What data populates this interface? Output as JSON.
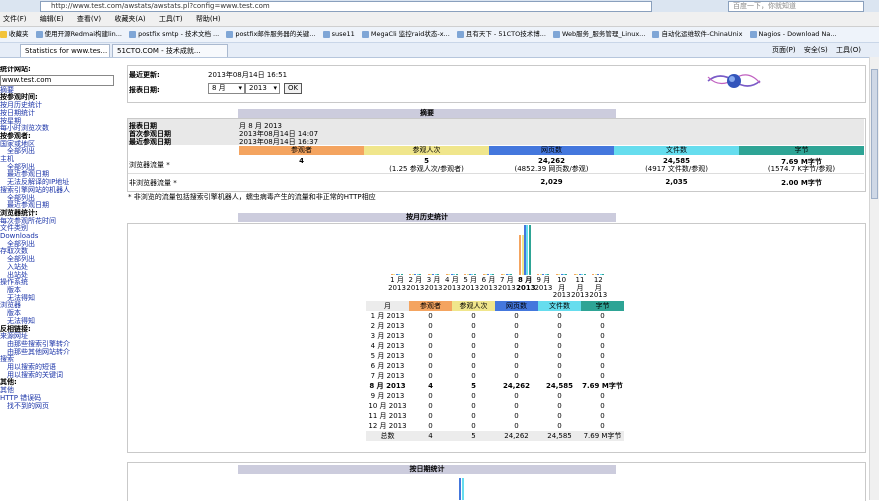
{
  "browser": {
    "url": "http://www.test.com/awstats/awstats.pl?config=www.test.com",
    "search_placeholder": "百度一下，你就知道",
    "menu": [
      "文件(F)",
      "编辑(E)",
      "查看(V)",
      "收藏夹(A)",
      "工具(T)",
      "帮助(H)"
    ],
    "favorites": [
      "收藏夹",
      "使用开源Redmai构建lin...",
      "postfix smtp - 技术文档 ...",
      "postfix邮件服务器的关键...",
      "suse11",
      "MegaCli 监控raid状态-x...",
      "且有天下 - 51CTO技术博...",
      "Web服务_服务管理_Linux...",
      "自动化运维软件-ChinaUnix",
      "Nagios - Download Na..."
    ],
    "tabs": [
      "Statistics for www.tes...",
      "51CTO.COM - 技术成就..."
    ],
    "commands": [
      "页面(P)",
      "安全(S)",
      "工具(O)"
    ]
  },
  "sidebar": {
    "site_label": "统计网站:",
    "site_value": "www.test.com",
    "items": [
      {
        "text": "摘要",
        "type": "lnk"
      },
      {
        "text": "按参观时间:",
        "type": "hdr"
      },
      {
        "text": "按月历史统计",
        "type": "lnk"
      },
      {
        "text": "按日期统计",
        "type": "lnk"
      },
      {
        "text": "按星期",
        "type": "lnk"
      },
      {
        "text": "每小时浏览次数",
        "type": "lnk"
      },
      {
        "text": "按参观者:",
        "type": "hdr"
      },
      {
        "text": "国家或地区",
        "type": "lnk"
      },
      {
        "text": "全部列出",
        "type": "sub"
      },
      {
        "text": "主机",
        "type": "lnk"
      },
      {
        "text": "全部列出",
        "type": "sub"
      },
      {
        "text": "最近参观日期",
        "type": "sub"
      },
      {
        "text": "无法反解译的IP地址",
        "type": "sub"
      },
      {
        "text": "搜索引擎网站的机器人",
        "type": "lnk"
      },
      {
        "text": "全部列出",
        "type": "sub"
      },
      {
        "text": "最近参观日期",
        "type": "sub"
      },
      {
        "text": "浏览器统计:",
        "type": "hdr"
      },
      {
        "text": "每次参观所花时间",
        "type": "lnk"
      },
      {
        "text": "文件类别",
        "type": "lnk"
      },
      {
        "text": "Downloads",
        "type": "lnk"
      },
      {
        "text": "全部列出",
        "type": "sub"
      },
      {
        "text": "存取次数",
        "type": "lnk"
      },
      {
        "text": "全部列出",
        "type": "sub"
      },
      {
        "text": "入站处",
        "type": "sub"
      },
      {
        "text": "出站处",
        "type": "sub"
      },
      {
        "text": "操作系统",
        "type": "lnk"
      },
      {
        "text": "版本",
        "type": "sub"
      },
      {
        "text": "无法得知",
        "type": "sub"
      },
      {
        "text": "浏览器",
        "type": "lnk"
      },
      {
        "text": "版本",
        "type": "sub"
      },
      {
        "text": "无法得知",
        "type": "sub"
      },
      {
        "text": "反相链接:",
        "type": "hdr"
      },
      {
        "text": "来源网址",
        "type": "lnk"
      },
      {
        "text": "由那些搜索引擎转介",
        "type": "sub"
      },
      {
        "text": "由那些其他网站转介",
        "type": "sub"
      },
      {
        "text": "搜索",
        "type": "lnk"
      },
      {
        "text": "用以搜索的短语",
        "type": "sub"
      },
      {
        "text": "用以搜索的关键词",
        "type": "sub"
      },
      {
        "text": "其他:",
        "type": "hdr"
      },
      {
        "text": "其他",
        "type": "lnk"
      },
      {
        "text": "HTTP 错误码",
        "type": "lnk"
      },
      {
        "text": "找不到的网页",
        "type": "sub"
      }
    ]
  },
  "header": {
    "last_update_label": "最近更新:",
    "last_update_value": "2013年08月14日 16:51",
    "report_date_label": "报表日期:",
    "month_value": "8 月",
    "year_value": "2013",
    "ok_label": "OK"
  },
  "summary": {
    "title": "摘要",
    "report_date_label": "报表日期",
    "report_date_value": "月 8 月 2013",
    "first_visit_label": "首次参观日期",
    "first_visit_value": "2013年08月14日 14:07",
    "last_visit_label": "最近参观日期",
    "last_visit_value": "2013年08月14日 16:37",
    "columns": [
      "参观者",
      "参观人次",
      "网页数",
      "文件数",
      "字节"
    ],
    "viewed_label": "浏览器流量 *",
    "viewed": [
      "4",
      "5",
      "24,262",
      "24,585",
      "7.69 M字节"
    ],
    "viewed_sub": [
      "",
      "(1.25 参观人次/参观者)",
      "(4852.39 网页数/参观)",
      "(4917 文件数/参观)",
      "(1574.7 K字节/参观)"
    ],
    "not_viewed_label": "非浏览器流量 *",
    "not_viewed": [
      "",
      "",
      "2,029",
      "2,035",
      "2.00 M字节"
    ],
    "note": "* 非浏览的流量包括搜索引擎机器人，蠕虫病毒产生的流量和非正常的HTTP相应"
  },
  "monthly": {
    "title": "按月历史统计",
    "columns": [
      "月",
      "参观者",
      "参观人次",
      "网页数",
      "文件数",
      "字节"
    ],
    "rows": [
      [
        "1 月 2013",
        "0",
        "0",
        "0",
        "0",
        "0"
      ],
      [
        "2 月 2013",
        "0",
        "0",
        "0",
        "0",
        "0"
      ],
      [
        "3 月 2013",
        "0",
        "0",
        "0",
        "0",
        "0"
      ],
      [
        "4 月 2013",
        "0",
        "0",
        "0",
        "0",
        "0"
      ],
      [
        "5 月 2013",
        "0",
        "0",
        "0",
        "0",
        "0"
      ],
      [
        "6 月 2013",
        "0",
        "0",
        "0",
        "0",
        "0"
      ],
      [
        "7 月 2013",
        "0",
        "0",
        "0",
        "0",
        "0"
      ],
      [
        "8 月 2013",
        "4",
        "5",
        "24,262",
        "24,585",
        "7.69 M字节"
      ],
      [
        "9 月 2013",
        "0",
        "0",
        "0",
        "0",
        "0"
      ],
      [
        "10 月 2013",
        "0",
        "0",
        "0",
        "0",
        "0"
      ],
      [
        "11 月 2013",
        "0",
        "0",
        "0",
        "0",
        "0"
      ],
      [
        "12 月 2013",
        "0",
        "0",
        "0",
        "0",
        "0"
      ]
    ],
    "total": [
      "总数",
      "4",
      "5",
      "24,262",
      "24,585",
      "7.69 M字节"
    ],
    "chart_months": [
      "1 月",
      "2 月",
      "3 月",
      "4 月",
      "5 月",
      "6 月",
      "7 月",
      "8 月",
      "9 月",
      "10 月",
      "11 月",
      "12 月"
    ],
    "chart_year": "2013"
  },
  "daily": {
    "title": "按日期统计"
  },
  "colors": {
    "visitors": "#f4a460",
    "visits": "#f0e68c",
    "pages": "#4477dd",
    "hits": "#66ddee",
    "bytes": "#2ea495"
  },
  "chart_data": {
    "type": "bar",
    "categories": [
      "1 月 2013",
      "2 月 2013",
      "3 月 2013",
      "4 月 2013",
      "5 月 2013",
      "6 月 2013",
      "7 月 2013",
      "8 月 2013",
      "9 月 2013",
      "10 月 2013",
      "11 月 2013",
      "12 月 2013"
    ],
    "series": [
      {
        "name": "参观者",
        "values": [
          0,
          0,
          0,
          0,
          0,
          0,
          0,
          4,
          0,
          0,
          0,
          0
        ]
      },
      {
        "name": "参观人次",
        "values": [
          0,
          0,
          0,
          0,
          0,
          0,
          0,
          5,
          0,
          0,
          0,
          0
        ]
      },
      {
        "name": "网页数",
        "values": [
          0,
          0,
          0,
          0,
          0,
          0,
          0,
          24262,
          0,
          0,
          0,
          0
        ]
      },
      {
        "name": "文件数",
        "values": [
          0,
          0,
          0,
          0,
          0,
          0,
          0,
          24585,
          0,
          0,
          0,
          0
        ]
      },
      {
        "name": "字节",
        "values": [
          0,
          0,
          0,
          0,
          0,
          0,
          0,
          7.69,
          0,
          0,
          0,
          0
        ]
      }
    ]
  }
}
